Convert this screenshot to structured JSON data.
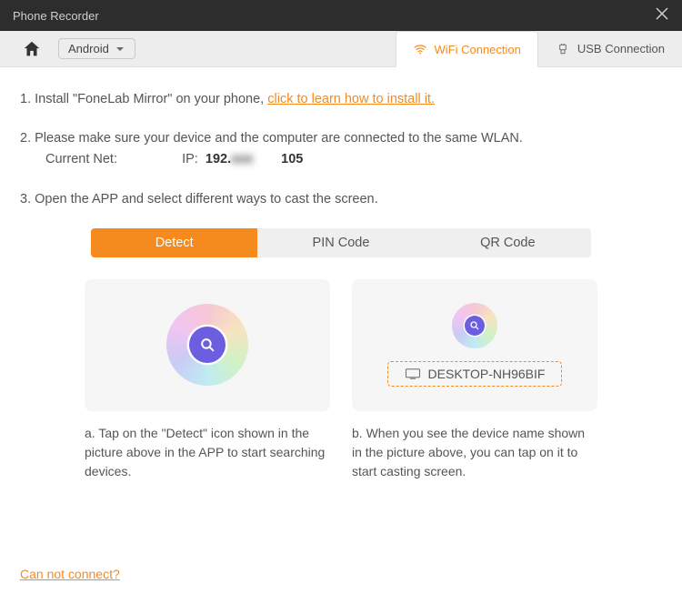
{
  "window": {
    "title": "Phone Recorder"
  },
  "toolbar": {
    "platform": "Android"
  },
  "conn": {
    "wifi": "WiFi Connection",
    "usb": "USB Connection"
  },
  "steps": {
    "s1_pre": "1. Install \"FoneLab Mirror\" on your phone, ",
    "s1_link": "click to learn how to install it.",
    "s2": "2. Please make sure your device and the computer are connected to the same WLAN.",
    "s2_net_label": "Current Net:",
    "s2_net_value": "  ",
    "s2_ip_label": "IP:",
    "s2_ip_a": "192.",
    "s2_ip_mid": "xxx",
    "s2_ip_b": "105",
    "s3": "3. Open the APP and select different ways to cast the screen."
  },
  "tabs": {
    "detect": "Detect",
    "pin": "PIN Code",
    "qr": "QR Code"
  },
  "panels": {
    "a": "a. Tap on the \"Detect\" icon shown in the picture above in the APP to start searching devices.",
    "b": "b. When you see the device name shown in the picture above, you can tap on it to start casting screen.",
    "device": "DESKTOP-NH96BIF"
  },
  "footer": {
    "cannot": "Can not connect?"
  }
}
